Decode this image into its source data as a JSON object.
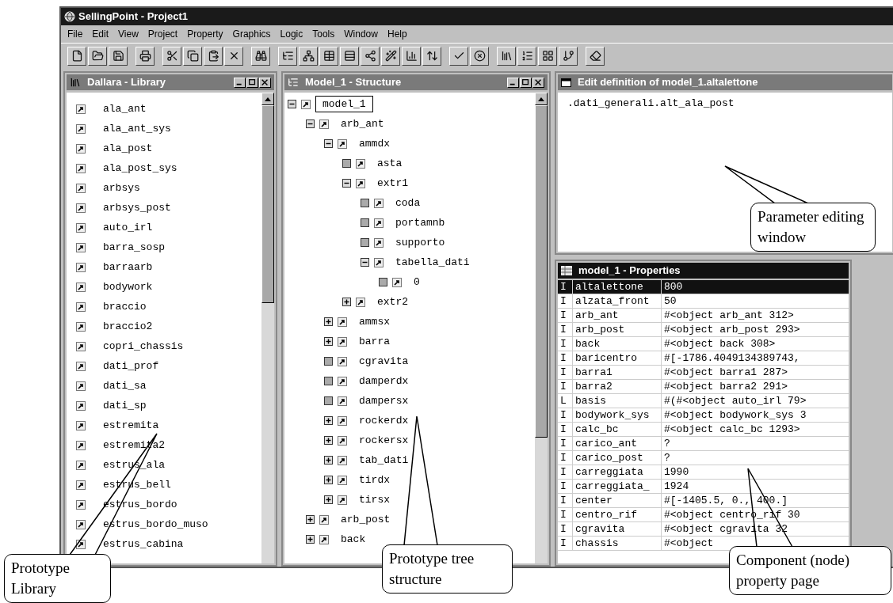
{
  "window": {
    "title": "SellingPoint - Project1"
  },
  "menu": [
    "File",
    "Edit",
    "View",
    "Project",
    "Property",
    "Graphics",
    "Logic",
    "Tools",
    "Window",
    "Help"
  ],
  "library": {
    "title": "Dallara - Library",
    "active": false,
    "items": [
      "ala_ant",
      "ala_ant_sys",
      "ala_post",
      "ala_post_sys",
      "arbsys",
      "arbsys_post",
      "auto_irl",
      "barra_sosp",
      "barraarb",
      "bodywork",
      "braccio",
      "braccio2",
      "copri_chassis",
      "dati_prof",
      "dati_sa",
      "dati_sp",
      "estremita",
      "estremita2",
      "estrus_ala",
      "estrus_bell",
      "estrus_bordo",
      "estrus_bordo_muso",
      "estrus_cabina"
    ]
  },
  "structure": {
    "title": "Model_1 - Structure",
    "active": false,
    "tree": [
      {
        "label": "model_1",
        "kind": "branch",
        "expanded": true,
        "selected": true,
        "children": [
          {
            "label": "arb_ant",
            "kind": "branch",
            "expanded": true,
            "selected": false,
            "children": [
              {
                "label": "ammdx",
                "kind": "branch",
                "expanded": true,
                "selected": false,
                "children": [
                  {
                    "label": "asta",
                    "kind": "leaf",
                    "expanded": false,
                    "selected": false
                  },
                  {
                    "label": "extr1",
                    "kind": "branch",
                    "expanded": true,
                    "selected": false,
                    "children": [
                      {
                        "label": "coda",
                        "kind": "leaf",
                        "expanded": false,
                        "selected": false
                      },
                      {
                        "label": "portamnb",
                        "kind": "leaf",
                        "expanded": false,
                        "selected": false
                      },
                      {
                        "label": "supporto",
                        "kind": "leaf",
                        "expanded": false,
                        "selected": false
                      },
                      {
                        "label": "tabella_dati",
                        "kind": "branch",
                        "expanded": true,
                        "selected": false,
                        "children": [
                          {
                            "label": "0",
                            "kind": "leaf",
                            "expanded": false,
                            "selected": false
                          }
                        ]
                      }
                    ]
                  },
                  {
                    "label": "extr2",
                    "kind": "branch",
                    "expanded": false,
                    "selected": false
                  }
                ]
              },
              {
                "label": "ammsx",
                "kind": "branch",
                "expanded": false,
                "selected": false
              },
              {
                "label": "barra",
                "kind": "branch",
                "expanded": false,
                "selected": false
              },
              {
                "label": "cgravita",
                "kind": "leaf",
                "expanded": false,
                "selected": false
              },
              {
                "label": "damperdx",
                "kind": "leaf",
                "expanded": false,
                "selected": false
              },
              {
                "label": "dampersx",
                "kind": "leaf",
                "expanded": false,
                "selected": false
              },
              {
                "label": "rockerdx",
                "kind": "branch",
                "expanded": false,
                "selected": false
              },
              {
                "label": "rockersx",
                "kind": "branch",
                "expanded": false,
                "selected": false
              },
              {
                "label": "tab_dati",
                "kind": "branch",
                "expanded": false,
                "selected": false
              },
              {
                "label": "tirdx",
                "kind": "branch",
                "expanded": false,
                "selected": false
              },
              {
                "label": "tirsx",
                "kind": "branch",
                "expanded": false,
                "selected": false
              }
            ]
          },
          {
            "label": "arb_post",
            "kind": "branch",
            "expanded": false,
            "selected": false
          },
          {
            "label": "back",
            "kind": "branch",
            "expanded": false,
            "selected": false
          }
        ]
      }
    ]
  },
  "editor": {
    "title": "Edit definition of model_1.altalettone",
    "active": false,
    "text": ".dati_generali.alt_ala_post"
  },
  "properties": {
    "title": "model_1 - Properties",
    "active": true,
    "rows": [
      {
        "type": "I",
        "name": "altalettone",
        "value": "800",
        "selected": true
      },
      {
        "type": "I",
        "name": "alzata_front",
        "value": "50",
        "selected": false
      },
      {
        "type": "I",
        "name": "arb_ant",
        "value": "#<object arb_ant 312>",
        "selected": false
      },
      {
        "type": "I",
        "name": "arb_post",
        "value": "#<object arb_post 293>",
        "selected": false
      },
      {
        "type": "I",
        "name": "back",
        "value": "#<object back 308>",
        "selected": false
      },
      {
        "type": "I",
        "name": "baricentro",
        "value": "#[-1786.4049134389743,",
        "selected": false
      },
      {
        "type": "I",
        "name": "barra1",
        "value": "#<object barra1 287>",
        "selected": false
      },
      {
        "type": "I",
        "name": "barra2",
        "value": "#<object barra2 291>",
        "selected": false
      },
      {
        "type": "L",
        "name": "basis",
        "value": "#(#<object auto_irl 79>",
        "selected": false
      },
      {
        "type": "I",
        "name": "bodywork_sys",
        "value": "#<object bodywork_sys 3",
        "selected": false
      },
      {
        "type": "I",
        "name": "calc_bc",
        "value": "#<object calc_bc 1293>",
        "selected": false
      },
      {
        "type": "I",
        "name": "carico_ant",
        "value": "?",
        "selected": false
      },
      {
        "type": "I",
        "name": "carico_post",
        "value": "?",
        "selected": false
      },
      {
        "type": "I",
        "name": "carreggiata",
        "value": "1990",
        "selected": false
      },
      {
        "type": "I",
        "name": "carreggiata_",
        "value": "1924",
        "selected": false
      },
      {
        "type": "I",
        "name": "center",
        "value": "#[-1405.5, 0., 400.]",
        "selected": false
      },
      {
        "type": "I",
        "name": "centro_rif",
        "value": "#<object centro_rif 30",
        "selected": false
      },
      {
        "type": "I",
        "name": "cgravita",
        "value": "#<object cgravita 32",
        "selected": false
      },
      {
        "type": "I",
        "name": "chassis",
        "value": "#<object",
        "selected": false
      }
    ]
  },
  "callouts": [
    {
      "text": "Prototype Library"
    },
    {
      "text": "Prototype tree structure"
    },
    {
      "text": "Parameter editing window"
    },
    {
      "text": "Component (node) property page"
    }
  ]
}
